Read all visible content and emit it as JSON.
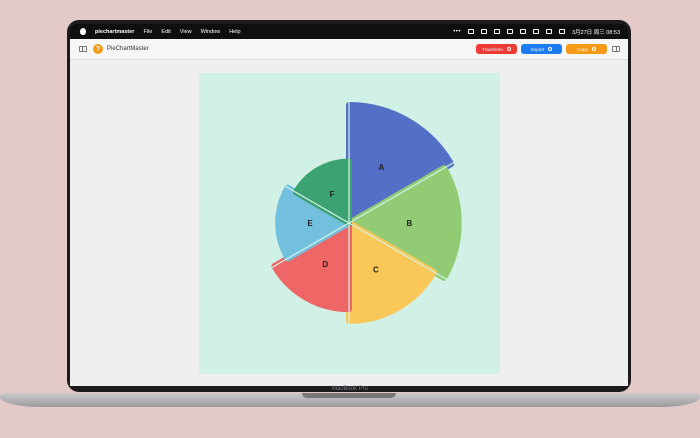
{
  "menubar": {
    "app_name": "piechartmaster",
    "items": [
      "File",
      "Edit",
      "View",
      "Window",
      "Help"
    ],
    "clock": "3月27日 周三  08:53",
    "more": "•••"
  },
  "toolbar": {
    "app_title": "PieChartMaster",
    "logo_glyph": "?",
    "buttons": [
      {
        "label": "Transform",
        "color": "#f03a35"
      },
      {
        "label": "Export",
        "color": "#1a7cf0"
      },
      {
        "label": "Copy",
        "color": "#f59a17"
      }
    ]
  },
  "canvas": {
    "background": "#d2f1e6"
  },
  "chart_data": {
    "type": "pie",
    "labels": [
      "A",
      "B",
      "C",
      "D",
      "E",
      "F"
    ],
    "values": [
      1,
      1,
      1,
      1,
      1,
      1
    ],
    "radii": [
      1.0,
      0.93,
      0.83,
      0.73,
      0.6,
      0.52
    ],
    "colors": [
      "#5470c6",
      "#91cc75",
      "#fac858",
      "#ee6666",
      "#73c0de",
      "#3ba272"
    ]
  },
  "laptop": {
    "brand": "MacBook Pro"
  }
}
